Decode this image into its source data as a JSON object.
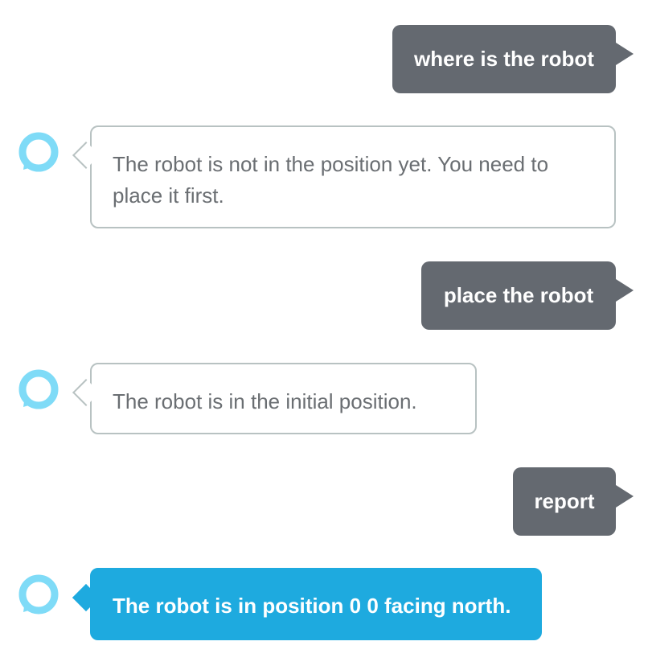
{
  "conversation": {
    "messages": [
      {
        "sender": "user",
        "text": "where is the robot"
      },
      {
        "sender": "bot",
        "text": "The robot is not in the position yet. You need to place it first.",
        "avatar_icon": "alexa-ring-icon"
      },
      {
        "sender": "user",
        "text": "place the robot"
      },
      {
        "sender": "bot",
        "text": "The robot is in the initial position.",
        "avatar_icon": "alexa-ring-icon"
      },
      {
        "sender": "user",
        "text": "report"
      },
      {
        "sender": "bot",
        "text": "The robot is in position 0 0 facing north.",
        "avatar_icon": "alexa-ring-icon",
        "state": "active"
      }
    ]
  },
  "colors": {
    "user_bubble": "#646970",
    "bot_bubble_border": "#b8c2c2",
    "bot_text": "#6a6e72",
    "active_bubble": "#1eaadf",
    "avatar_ring": "#7fdbf7"
  }
}
